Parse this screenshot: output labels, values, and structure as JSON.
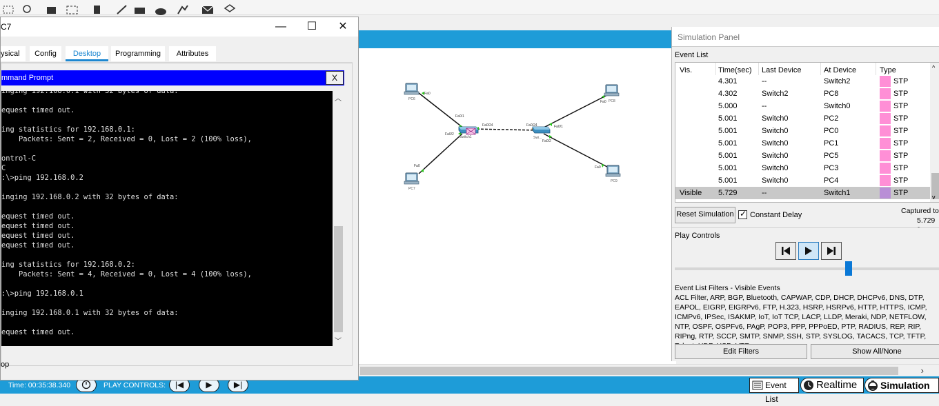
{
  "pc_window": {
    "title": "C7",
    "controls": {
      "minimize": "—",
      "maximize": "☐",
      "close": "✕"
    },
    "tabs": [
      "ysical",
      "Config",
      "Desktop",
      "Programming",
      "Attributes"
    ],
    "active_tab": "Desktop",
    "cmd_title": "mmand Prompt",
    "cmd_close": "X",
    "console_text": "inging 192.168.0.1 with 32 bytes of data:\n\nequest timed out.\n\ning statistics for 192.168.0.1:\n    Packets: Sent = 2, Received = 0, Lost = 2 (100% loss),\n\nontrol-C\nC\n:\\>ping 192.168.0.2\n\ninging 192.168.0.2 with 32 bytes of data:\n\nequest timed out.\nequest timed out.\nequest timed out.\nequest timed out.\n\ning statistics for 192.168.0.2:\n    Packets: Sent = 4, Received = 0, Lost = 4 (100% loss),\n\n:\\>ping 192.168.0.1\n\ninging 192.168.0.1 with 32 bytes of data:\n\nequest timed out.",
    "footer": "op"
  },
  "status_bar": {
    "time_label": "Time: 00:35:38.340",
    "play_controls_label": "PLAY CONTROLS:",
    "event_list_button": "Event List",
    "realtime_button": "Realtime",
    "simulation_button": "Simulation"
  },
  "network": {
    "devices": [
      {
        "name": "PC6"
      },
      {
        "name": "PC7"
      },
      {
        "name": "PC8"
      },
      {
        "name": "PC9"
      },
      {
        "name": "Switch1"
      },
      {
        "name": "Swi..."
      }
    ],
    "ports": {
      "pc6": "Fa0",
      "pc7": "Fa0",
      "pc8": "Fa0",
      "pc9": "Fa0",
      "s1_fa01": "Fa0/1",
      "s1_fa02": "Fa0/2",
      "s1_fa024": "Fa0/24",
      "s2_fa024": "Fa0/24",
      "s2_fa01": "Fa0/1",
      "s2_fa02": "Fa0/2"
    }
  },
  "sim_panel": {
    "title": "Simulation Panel",
    "event_list_label": "Event List",
    "columns": [
      "Vis.",
      "Time(sec)",
      "Last Device",
      "At Device",
      "Type"
    ],
    "events": [
      {
        "vis": "",
        "time": "4.301",
        "last": "--",
        "at": "Switch2",
        "type": "STP",
        "color": "#ff8fd6"
      },
      {
        "vis": "",
        "time": "4.302",
        "last": "Switch2",
        "at": "PC8",
        "type": "STP",
        "color": "#ff8fd6"
      },
      {
        "vis": "",
        "time": "5.000",
        "last": "--",
        "at": "Switch0",
        "type": "STP",
        "color": "#ff8fd6"
      },
      {
        "vis": "",
        "time": "5.001",
        "last": "Switch0",
        "at": "PC2",
        "type": "STP",
        "color": "#ff8fd6"
      },
      {
        "vis": "",
        "time": "5.001",
        "last": "Switch0",
        "at": "PC0",
        "type": "STP",
        "color": "#ff8fd6"
      },
      {
        "vis": "",
        "time": "5.001",
        "last": "Switch0",
        "at": "PC1",
        "type": "STP",
        "color": "#ff8fd6"
      },
      {
        "vis": "",
        "time": "5.001",
        "last": "Switch0",
        "at": "PC5",
        "type": "STP",
        "color": "#ff8fd6"
      },
      {
        "vis": "",
        "time": "5.001",
        "last": "Switch0",
        "at": "PC3",
        "type": "STP",
        "color": "#ff8fd6"
      },
      {
        "vis": "",
        "time": "5.001",
        "last": "Switch0",
        "at": "PC4",
        "type": "STP",
        "color": "#ff8fd6"
      },
      {
        "vis": "Visible",
        "time": "5.729",
        "last": "--",
        "at": "Switch1",
        "type": "STP",
        "color": "#b98ed6",
        "selected": true
      }
    ],
    "reset_button": "Reset Simulation",
    "constant_delay_label": "Constant Delay",
    "constant_delay_checked": true,
    "captured_label": "Captured to",
    "captured_value": "5.729 s",
    "play_controls_label": "Play Controls",
    "filters_title": "Event List Filters - Visible Events",
    "filters_text": "ACL Filter, ARP, BGP, Bluetooth, CAPWAP, CDP, DHCP, DHCPv6, DNS, DTP, EAPOL, EIGRP, EIGRPv6, FTP, H.323, HSRP, HSRPv6, HTTP, HTTPS, ICMP, ICMPv6, IPSec, ISAKMP, IoT, IoT TCP, LACP, LLDP, Meraki, NDP, NETFLOW, NTP, OSPF, OSPFv6, PAgP, POP3, PPP, PPPoED, PTP, RADIUS, REP, RIP, RIPng, RTP, SCCP, SMTP, SNMP, SSH, STP, SYSLOG, TACACS, TCP, TFTP, Telnet, UDP, USB, VTP",
    "edit_filters_button": "Edit Filters",
    "show_all_button": "Show All/None",
    "slider_value": 0.66
  },
  "colors": {
    "accent_blue": "#1e9cd8",
    "cmd_title_blue": "#0000fe",
    "stp_pink": "#ff8fd6",
    "stp_selected": "#b98ed6"
  }
}
